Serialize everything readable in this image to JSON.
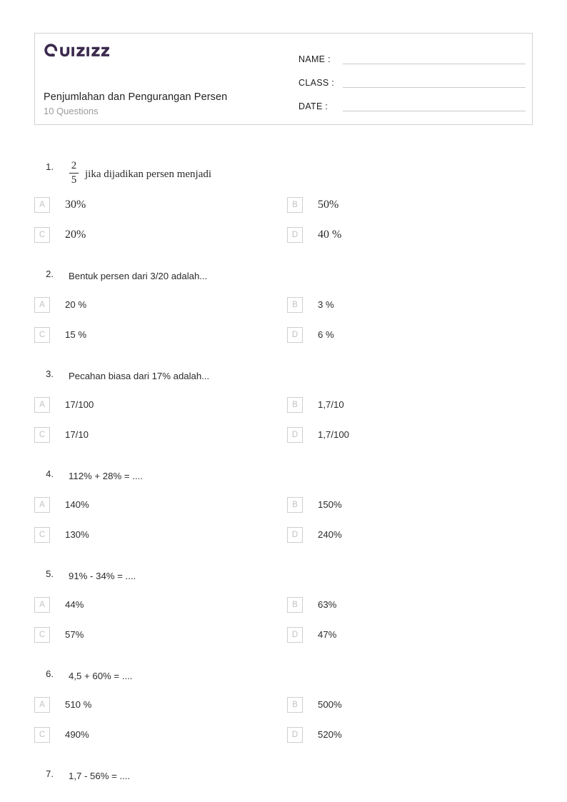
{
  "header": {
    "brand_name": "Quizizz",
    "brand_color": "#3b2a4d",
    "title": "Penjumlahan dan Pengurangan Persen",
    "subtitle": "10 Questions",
    "fields": [
      {
        "label": "NAME :"
      },
      {
        "label": "CLASS :"
      },
      {
        "label": "DATE  :"
      }
    ]
  },
  "questions": [
    {
      "number": "1.",
      "style": "serif",
      "fraction": {
        "numerator": "2",
        "denominator": "5"
      },
      "text": "jika dijadikan persen menjadi",
      "options": [
        {
          "letter": "A",
          "text": "30%"
        },
        {
          "letter": "B",
          "text": "50%"
        },
        {
          "letter": "C",
          "text": "20%"
        },
        {
          "letter": "D",
          "text": "40 %"
        }
      ]
    },
    {
      "number": "2.",
      "style": "sans",
      "text": "Bentuk persen dari 3/20 adalah...",
      "options": [
        {
          "letter": "A",
          "text": "20 %"
        },
        {
          "letter": "B",
          "text": "3 %"
        },
        {
          "letter": "C",
          "text": "15 %"
        },
        {
          "letter": "D",
          "text": "6 %"
        }
      ]
    },
    {
      "number": "3.",
      "style": "sans",
      "text": "Pecahan biasa dari 17% adalah...",
      "options": [
        {
          "letter": "A",
          "text": "17/100"
        },
        {
          "letter": "B",
          "text": "1,7/10"
        },
        {
          "letter": "C",
          "text": "17/10"
        },
        {
          "letter": "D",
          "text": "1,7/100"
        }
      ]
    },
    {
      "number": "4.",
      "style": "sans",
      "text": "112% + 28% = ....",
      "options": [
        {
          "letter": "A",
          "text": "140%"
        },
        {
          "letter": "B",
          "text": "150%"
        },
        {
          "letter": "C",
          "text": "130%"
        },
        {
          "letter": "D",
          "text": "240%"
        }
      ]
    },
    {
      "number": "5.",
      "style": "sans",
      "text": "91% - 34% = ....",
      "options": [
        {
          "letter": "A",
          "text": "44%"
        },
        {
          "letter": "B",
          "text": "63%"
        },
        {
          "letter": "C",
          "text": "57%"
        },
        {
          "letter": "D",
          "text": "47%"
        }
      ]
    },
    {
      "number": "6.",
      "style": "sans",
      "text": "4,5 + 60% = ....",
      "options": [
        {
          "letter": "A",
          "text": "510 %"
        },
        {
          "letter": "B",
          "text": "500%"
        },
        {
          "letter": "C",
          "text": "490%"
        },
        {
          "letter": "D",
          "text": "520%"
        }
      ]
    },
    {
      "number": "7.",
      "style": "sans",
      "text": "1,7 - 56% = ....",
      "options": []
    }
  ]
}
